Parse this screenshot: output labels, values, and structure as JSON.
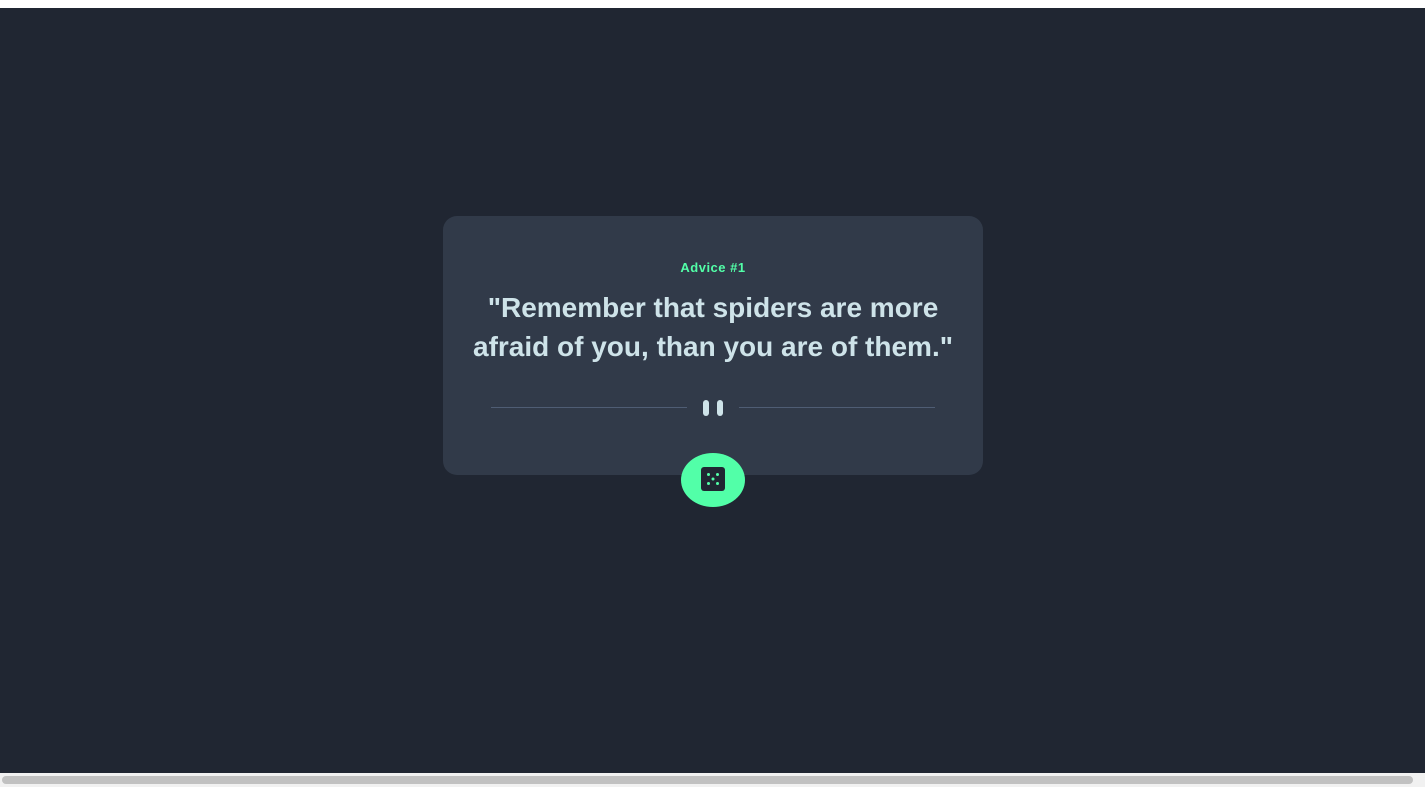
{
  "advice": {
    "label": "Advice #1",
    "quote": "\"Remember that spiders are more afraid of you, than you are of them.\""
  },
  "icons": {
    "divider": "pause-icon",
    "button": "dice-icon"
  },
  "colors": {
    "background": "#202632",
    "card": "#313a49",
    "accent": "#52ffa8",
    "text": "#cee3e9",
    "divider": "#4f5d74"
  }
}
